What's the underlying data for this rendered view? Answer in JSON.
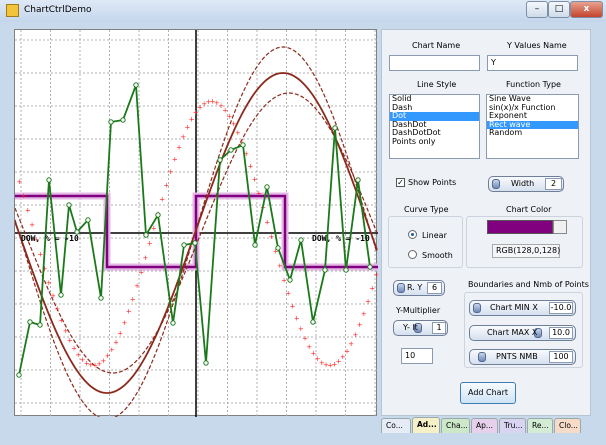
{
  "window": {
    "title": "ChartCtrlDemo",
    "min": "–",
    "max": "□",
    "close": "x"
  },
  "chart": {
    "labels": [
      {
        "text": "DOW, %  = -10"
      },
      {
        "text": "DOW, %  = -10"
      }
    ]
  },
  "panel": {
    "chart_name_label": "Chart Name",
    "chart_name_value": "",
    "y_values_label": "Y Values Name",
    "y_values_value": "Y",
    "line_style_label": "Line Style",
    "line_styles": [
      {
        "label": "Solid",
        "selected": false
      },
      {
        "label": "Dash",
        "selected": false
      },
      {
        "label": "Dot",
        "selected": true
      },
      {
        "label": "DashDot",
        "selected": false
      },
      {
        "label": "DashDotDot",
        "selected": false
      },
      {
        "label": "Points only",
        "selected": false
      }
    ],
    "function_type_label": "Function Type",
    "functions": [
      {
        "label": "Sine Wave",
        "selected": false
      },
      {
        "label": "sin(x)/x Function",
        "selected": false
      },
      {
        "label": "Exponent",
        "selected": false
      },
      {
        "label": "Rect wave",
        "selected": true
      },
      {
        "label": "Random",
        "selected": false
      }
    ],
    "show_points_label": "Show Points",
    "show_points_checked": true,
    "width_label": "Width",
    "width_value": "2",
    "curve_type_label": "Curve Type",
    "linear_label": "Linear",
    "smooth_label": "Smooth",
    "chart_color_label": "Chart Color",
    "chart_color": "#800080",
    "rgb_text": "RGB(128,0,128)",
    "ry_label": "R.    Y",
    "ry_value": "6",
    "y_multiplier_label": "Y-Multiplier",
    "ymult_label": "Y-    lt",
    "ymult_value": "1",
    "multiplier_value": "10",
    "boundaries_label": "Boundaries  and Nmb of Points",
    "chart_min_label": "Chart MIN X",
    "chart_min_value": "-10.0",
    "chart_max_label": "Chart MAX X",
    "chart_max_value": "10.0",
    "pnts_label": "PNTS NMB",
    "pnts_value": "100",
    "add_chart_label": "Add Chart"
  },
  "tabs": [
    {
      "label": "Co..."
    },
    {
      "label": "Ad..."
    },
    {
      "label": "Cha..."
    },
    {
      "label": "Ap..."
    },
    {
      "label": "Tru..."
    },
    {
      "label": "Re..."
    },
    {
      "label": "Clo..."
    }
  ],
  "colors": {
    "sine": "#8b2a1c",
    "sine_dashed": "#8b2a1c",
    "dotted": "#ff2020",
    "random": "#1a7a1a",
    "rect": "#800080",
    "rect_glow": "#e6b8e6",
    "tab_colors": [
      "#e6ecf6",
      "#f6f0c8",
      "#cde8c8",
      "#e6d0ec",
      "#d8d4f2",
      "#d4ecd4",
      "#f6dcc8"
    ]
  },
  "icons": {
    "app": "app-icon",
    "min": "minimize-icon",
    "max": "maximize-icon",
    "close": "close-icon"
  }
}
